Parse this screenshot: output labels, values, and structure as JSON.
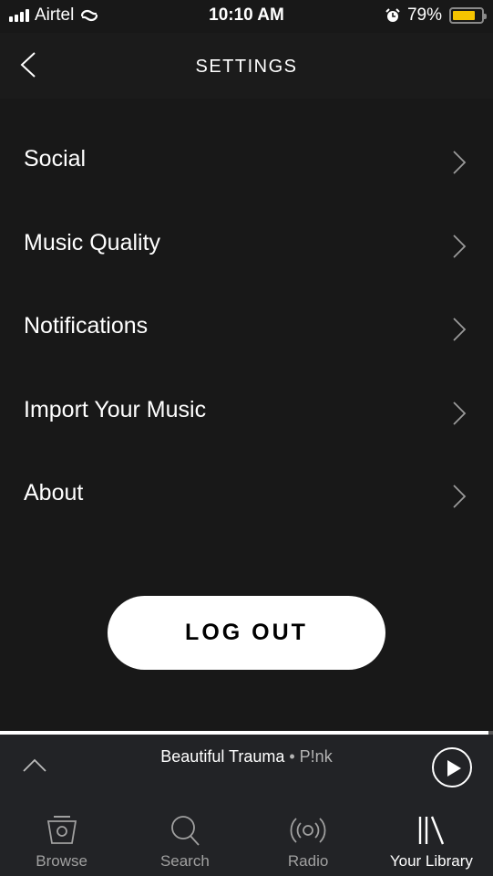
{
  "status_bar": {
    "carrier": "Airtel",
    "time": "10:10 AM",
    "battery_percent_label": "79%",
    "battery_level": 0.79,
    "signal_bars": 4,
    "icons": [
      "signal-icon",
      "hotspot-link-icon",
      "alarm-icon",
      "battery-icon"
    ]
  },
  "header": {
    "title": "SETTINGS",
    "back_icon": "chevron-left-icon"
  },
  "settings": {
    "items": [
      {
        "label": "Social",
        "icon": "chevron-right-icon"
      },
      {
        "label": "Music Quality",
        "icon": "chevron-right-icon"
      },
      {
        "label": "Notifications",
        "icon": "chevron-right-icon"
      },
      {
        "label": "Import Your Music",
        "icon": "chevron-right-icon"
      },
      {
        "label": "About",
        "icon": "chevron-right-icon"
      }
    ]
  },
  "logout": {
    "label": "LOG OUT"
  },
  "now_playing": {
    "title": "Beautiful Trauma",
    "separator": " • ",
    "artist": "P!nk",
    "progress": 0.99,
    "expand_icon": "chevron-up-icon",
    "play_icon": "play-icon"
  },
  "tab_bar": {
    "tabs": [
      {
        "label": "Browse",
        "icon": "browse-icon",
        "active": false
      },
      {
        "label": "Search",
        "icon": "search-icon",
        "active": false
      },
      {
        "label": "Radio",
        "icon": "radio-icon",
        "active": false
      },
      {
        "label": "Your Library",
        "icon": "library-icon",
        "active": true
      }
    ]
  },
  "colors": {
    "background": "#181818",
    "bar_background": "#222326",
    "battery": "#f5c400",
    "text_primary": "#ffffff",
    "text_secondary": "#a0a0a0"
  }
}
